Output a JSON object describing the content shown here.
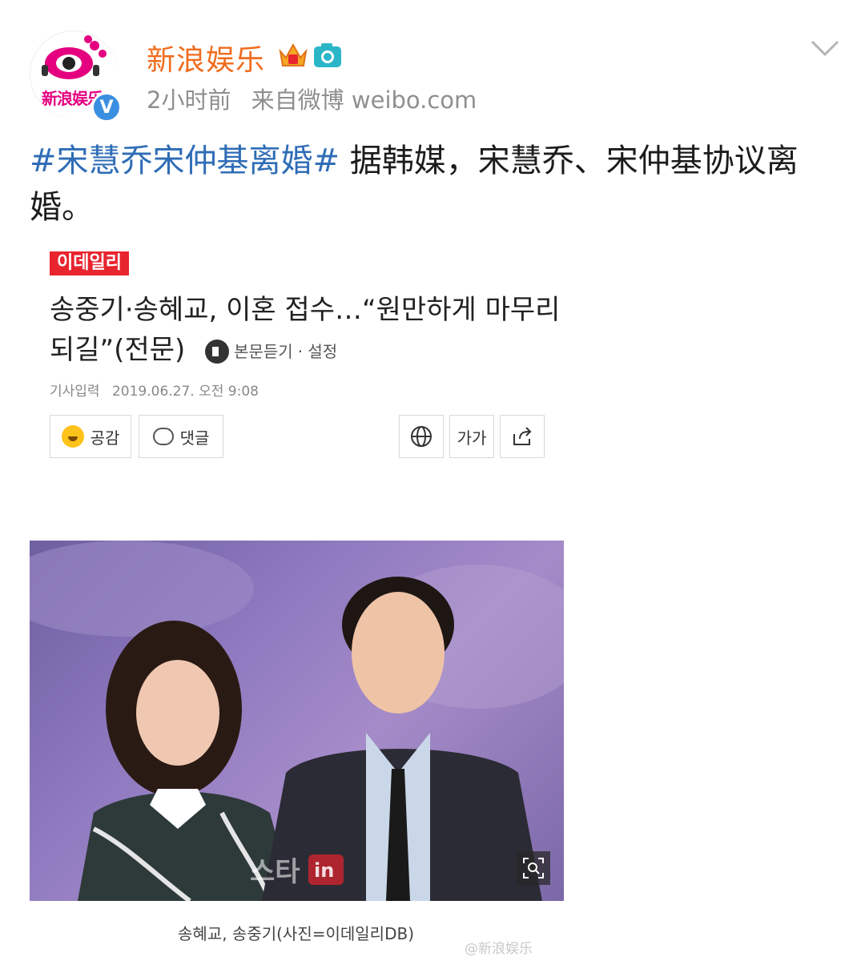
{
  "header": {
    "username": "新浪娱乐",
    "avatar_text": "新浪娱乐",
    "verified_mark": "V",
    "time": "2小时前",
    "source": "来自微博 weibo.com"
  },
  "post": {
    "topic": "#宋慧乔宋仲基离婚#",
    "text": " 据韩媒，宋慧乔、宋仲基协议离婚。"
  },
  "article": {
    "logo": "이데일리",
    "headline": "송중기·송혜교, 이혼 접수…“원만하게 마무리 되길”(전문)",
    "listen_label": "본문듣기",
    "settings_label": "· 설정",
    "date_label": "기사입력",
    "date": "2019.06.27. 오전 9:08",
    "buttons": {
      "like": "공감",
      "comment": "댓글",
      "font": "가가"
    },
    "photo_watermark": "스타in",
    "caption": "송혜교, 송중기(사진=이데일리DB)"
  },
  "watermark": "@新浪娱乐",
  "colors": {
    "username": "#f06c1e",
    "topic": "#2f6db6",
    "verified": "#3b8fe0",
    "logo_red": "#e8242e"
  }
}
